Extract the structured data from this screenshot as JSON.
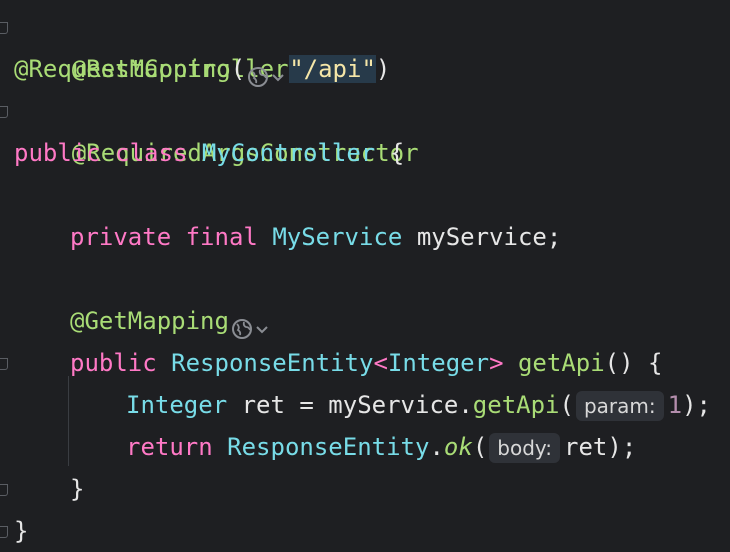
{
  "code": {
    "l1": {
      "annotation": "@RestController"
    },
    "l2": {
      "annotation": "@RequestMapping",
      "open": "(",
      "value": "\"/api\"",
      "close": ")"
    },
    "l3": {
      "annotation": "@RequiredArgsConstructor"
    },
    "l4": {
      "kw1": "public",
      "kw2": "class",
      "name": "MyController",
      "brace": "{"
    },
    "l6": {
      "kw1": "private",
      "kw2": "final",
      "type": "MyService",
      "var": "myService;"
    },
    "l8": {
      "annotation": "@GetMapping"
    },
    "l9": {
      "kw1": "public",
      "type": "ResponseEntity",
      "lt": "<",
      "generic": "Integer",
      "gt": ">",
      "method": "getApi",
      "rest": "() {"
    },
    "l10": {
      "type": "Integer",
      "var": "ret = myService.",
      "method": "getApi",
      "open": "(",
      "hint": "param:",
      "num": "1",
      "close": ");"
    },
    "l11": {
      "kw": "return",
      "type": "ResponseEntity",
      "dot": ".",
      "method": "ok",
      "open": "(",
      "hint": "body:",
      "rest": "ret);"
    },
    "l12": {
      "brace": "}"
    },
    "l13": {
      "brace": "}"
    }
  },
  "icons": {
    "globe": "globe-icon",
    "chevron": "chevron-down-icon"
  },
  "colors": {
    "background": "#1e1f22",
    "annotation": "#a9dc76",
    "keyword": "#ff79c6",
    "type": "#78dce8",
    "string": "#f5e6a8",
    "number": "#b48ead"
  }
}
